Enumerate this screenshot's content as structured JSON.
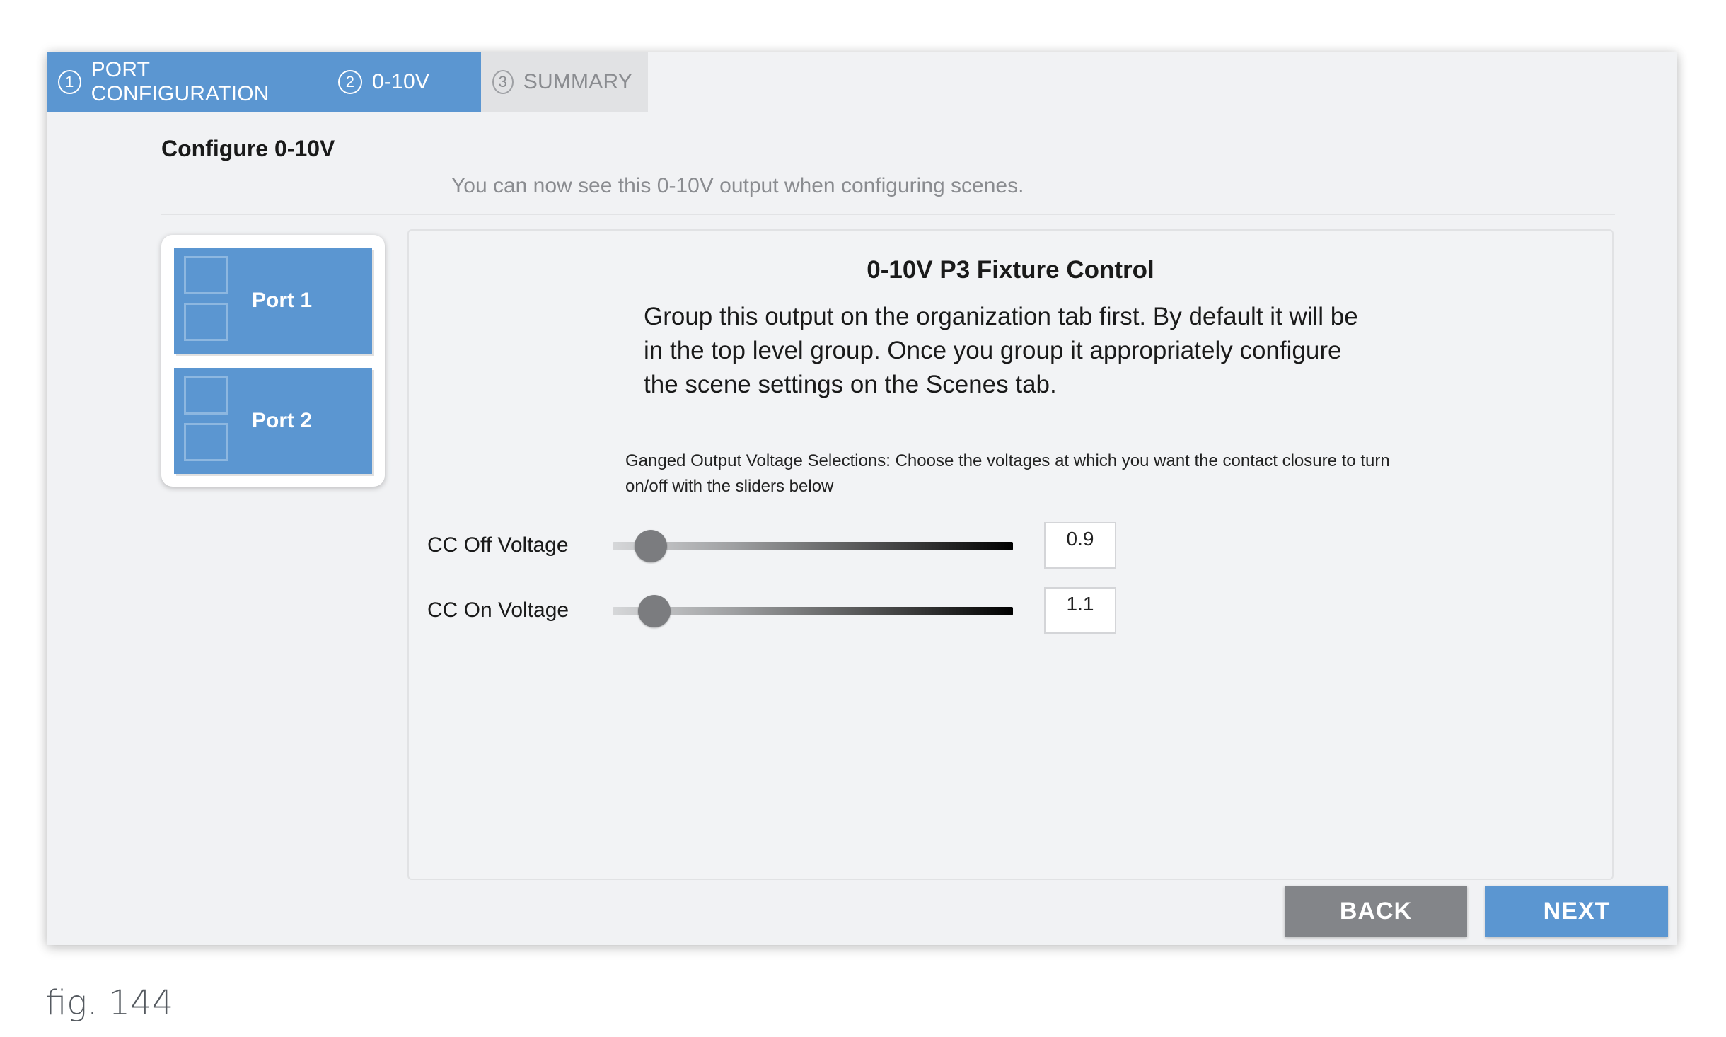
{
  "steps": [
    {
      "num": "1",
      "label": "PORT CONFIGURATION",
      "state": "completed"
    },
    {
      "num": "2",
      "label": "0-10V",
      "state": "active"
    },
    {
      "num": "3",
      "label": "SUMMARY",
      "state": "pending"
    }
  ],
  "page": {
    "heading": "Configure 0-10V",
    "subtitle": "You can now see this 0-10V output when configuring scenes."
  },
  "ports": [
    {
      "label": "Port 1"
    },
    {
      "label": "Port 2"
    }
  ],
  "main": {
    "title": "0-10V P3 Fixture Control",
    "description": "Group this output on the organization tab first. By default it will be in the top level group. Once you group it appropriately configure the scene settings on the Scenes tab.",
    "note": "Ganged Output Voltage Selections: Choose the voltages at which you want the contact closure to turn on/off with the sliders below",
    "sliders": [
      {
        "label": "CC Off Voltage",
        "value": "0.9",
        "fraction": 0.06
      },
      {
        "label": "CC On Voltage",
        "value": "1.1",
        "fraction": 0.07
      }
    ]
  },
  "buttons": {
    "back": "BACK",
    "next": "NEXT"
  },
  "caption": "fig. 144",
  "colors": {
    "accent": "#5b96d1",
    "inactive_step": "#e1e2e4",
    "back_button": "#838589"
  }
}
